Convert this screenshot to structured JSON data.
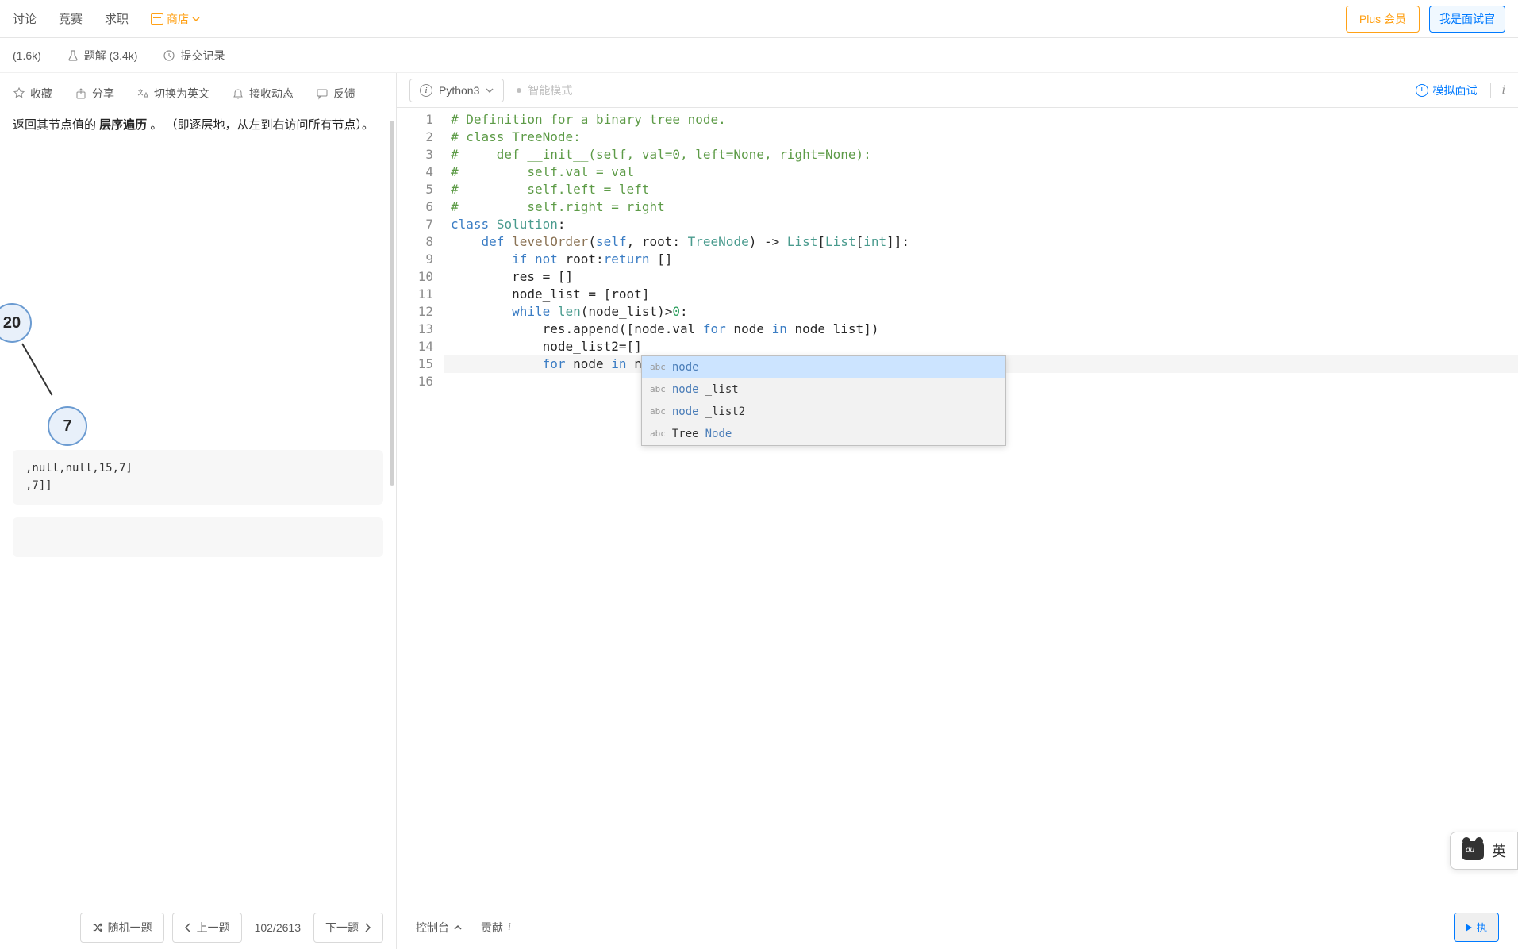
{
  "nav": {
    "discuss": "讨论",
    "contest": "竞赛",
    "jobs": "求职",
    "store": "商店"
  },
  "topRight": {
    "plus": "Plus 会员",
    "interviewer": "我是面试官"
  },
  "tabs": {
    "comments": "(1.6k)",
    "solutions": "题解 (3.4k)",
    "submissions": "提交记录"
  },
  "actions": {
    "favorite": "收藏",
    "share": "分享",
    "switchLang": "切换为英文",
    "subscribe": "接收动态",
    "feedback": "反馈"
  },
  "description": {
    "prefix": "返回其节点值的 ",
    "bold": "层序遍历",
    "suffix": " 。 （即逐层地，从左到右访问所有节点）。"
  },
  "tree": {
    "node20": "20",
    "node7": "7"
  },
  "example": {
    "line1": ",null,null,15,7]",
    "line2": ",7]]"
  },
  "editor": {
    "language": "Python3",
    "mode": "智能模式",
    "mockInterview": "模拟面试"
  },
  "code": {
    "lines": [
      {
        "n": 1,
        "html": "<span class='tok-comment'># Definition for a binary tree node.</span>"
      },
      {
        "n": 2,
        "html": "<span class='tok-comment'># class TreeNode:</span>"
      },
      {
        "n": 3,
        "html": "<span class='tok-comment'>#     def __init__(self, val=0, left=None, right=None):</span>"
      },
      {
        "n": 4,
        "html": "<span class='tok-comment'>#         self.val = val</span>"
      },
      {
        "n": 5,
        "html": "<span class='tok-comment'>#         self.left = left</span>"
      },
      {
        "n": 6,
        "html": "<span class='tok-comment'>#         self.right = right</span>"
      },
      {
        "n": 7,
        "html": "<span class='tok-keyword'>class</span> <span class='tok-class'>Solution</span>:"
      },
      {
        "n": 8,
        "html": "    <span class='tok-def'>def</span> <span class='tok-func'>levelOrder</span>(<span class='tok-self'>self</span>, root: <span class='tok-type'>TreeNode</span>) -> <span class='tok-type'>List</span>[<span class='tok-type'>List</span>[<span class='tok-builtin'>int</span>]]:"
      },
      {
        "n": 9,
        "html": "        <span class='tok-keyword'>if</span> <span class='tok-keyword'>not</span> root:<span class='tok-keyword'>return</span> []"
      },
      {
        "n": 10,
        "html": "        res = []"
      },
      {
        "n": 11,
        "html": "        node_list = [root]"
      },
      {
        "n": 12,
        "html": "        <span class='tok-keyword'>while</span> <span class='tok-builtin'>len</span>(node_list)><span class='tok-num'>0</span>:"
      },
      {
        "n": 13,
        "html": "            res.append([node.val <span class='tok-keyword'>for</span> node <span class='tok-keyword'>in</span> node_list])"
      },
      {
        "n": 14,
        "html": "            node_list2=[]"
      },
      {
        "n": 15,
        "html": "            <span class='tok-keyword'>for</span> node <span class='tok-keyword'>in</span> node",
        "active": true
      },
      {
        "n": 16,
        "html": ""
      }
    ]
  },
  "autocomplete": {
    "items": [
      {
        "kind": "abc",
        "match": "node",
        "rest": "",
        "selected": true
      },
      {
        "kind": "abc",
        "match": "node",
        "rest": "_list"
      },
      {
        "kind": "abc",
        "match": "node",
        "rest": "_list2"
      },
      {
        "kind": "abc",
        "match": "",
        "prefix": "Tree",
        "matchEnd": "Node",
        "rest": ""
      }
    ]
  },
  "bottomNav": {
    "random": "随机一题",
    "prev": "上一题",
    "pageIndicator": "102/2613",
    "next": "下一题"
  },
  "bottomRight": {
    "console": "控制台",
    "contribute": "贡献",
    "run": "执"
  },
  "widget": {
    "bearText": "du",
    "label": "英"
  }
}
